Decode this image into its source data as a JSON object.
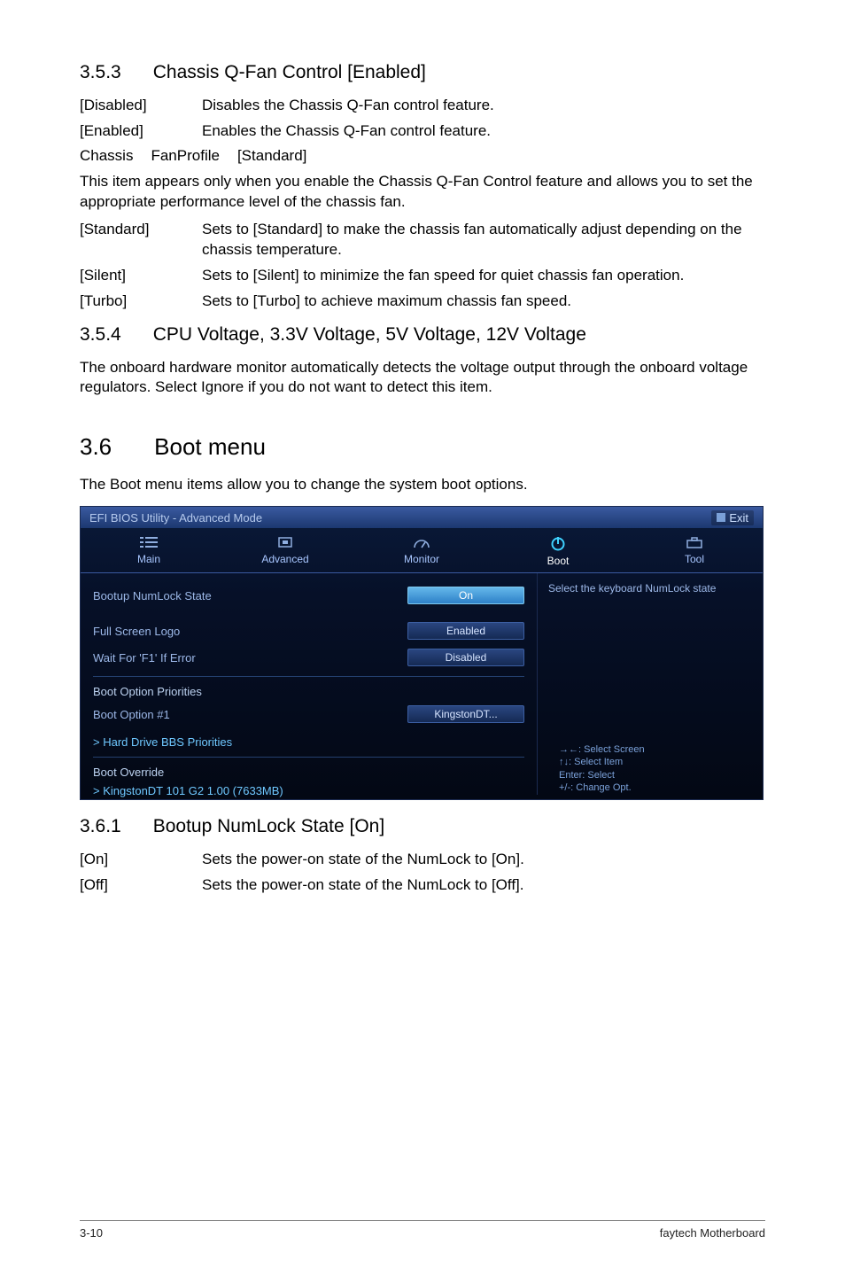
{
  "sections": {
    "s353": {
      "num": "3.5.3",
      "title": "Chassis Q-Fan Control [Enabled]"
    },
    "s354": {
      "num": "3.5.4",
      "title": "CPU Voltage, 3.3V Voltage, 5V Voltage, 12V Voltage"
    },
    "s36": {
      "num": "3.6",
      "title": "Boot menu"
    },
    "s361": {
      "num": "3.6.1",
      "title": "Bootup NumLock State [On]"
    }
  },
  "qfan": {
    "rows": [
      {
        "label": "[Disabled]",
        "value": "Disables the Chassis Q-Fan control feature."
      },
      {
        "label": "[Enabled]",
        "value": "Enables the Chassis Q-Fan control feature."
      }
    ],
    "profile_line": {
      "a": "Chassis",
      "b": "FanProfile",
      "c": "[Standard]"
    },
    "profile_intro": "This item appears only when you enable the Chassis Q-Fan Control feature and allows you to set the appropriate performance level of the chassis fan.",
    "profile_rows": [
      {
        "label": "[Standard]",
        "value": "Sets to [Standard] to make the chassis fan automatically adjust depending on the chassis temperature."
      },
      {
        "label": "[Silent]",
        "value": "Sets to [Silent] to minimize the fan speed for quiet chassis fan operation."
      },
      {
        "label": "[Turbo]",
        "value": "Sets to [Turbo] to achieve maximum chassis fan speed."
      }
    ]
  },
  "voltage_text": "The onboard hardware monitor automatically detects the voltage output through the onboard voltage regulators. Select Ignore if you do not want to detect this item.",
  "boot_intro": "The Boot menu items allow you to change the system boot options.",
  "numlock_rows": [
    {
      "label": "[On]",
      "value": "Sets the power-on state of the NumLock to [On]."
    },
    {
      "label": "[Off]",
      "value": "Sets the power-on state of the NumLock to [Off]."
    }
  ],
  "bios": {
    "title": "EFI BIOS Utility - Advanced Mode",
    "exit": "Exit",
    "tabs": {
      "main": "Main",
      "advanced": "Advanced",
      "monitor": "Monitor",
      "boot": "Boot",
      "tool": "Tool"
    },
    "help": "Select the keyboard NumLock state",
    "items": {
      "numlock": {
        "label": "Bootup NumLock State",
        "value": "On"
      },
      "logo": {
        "label": "Full Screen Logo",
        "value": "Enabled"
      },
      "waitf1": {
        "label": "Wait For 'F1' If Error",
        "value": "Disabled"
      },
      "priorities_header": "Boot Option Priorities",
      "opt1": {
        "label": "Boot Option #1",
        "value": "KingstonDT..."
      },
      "hdbbs": "> Hard Drive BBS Priorities",
      "override_header": "Boot Override",
      "override1": "> KingstonDT 101 G2 1.00  (7633MB)"
    },
    "legend": {
      "l1": "→←: Select Screen",
      "l2": "↑↓: Select Item",
      "l3": "Enter: Select",
      "l4": "+/-: Change Opt."
    }
  },
  "footer": {
    "left": "3-10",
    "right": "faytech Motherboard"
  }
}
